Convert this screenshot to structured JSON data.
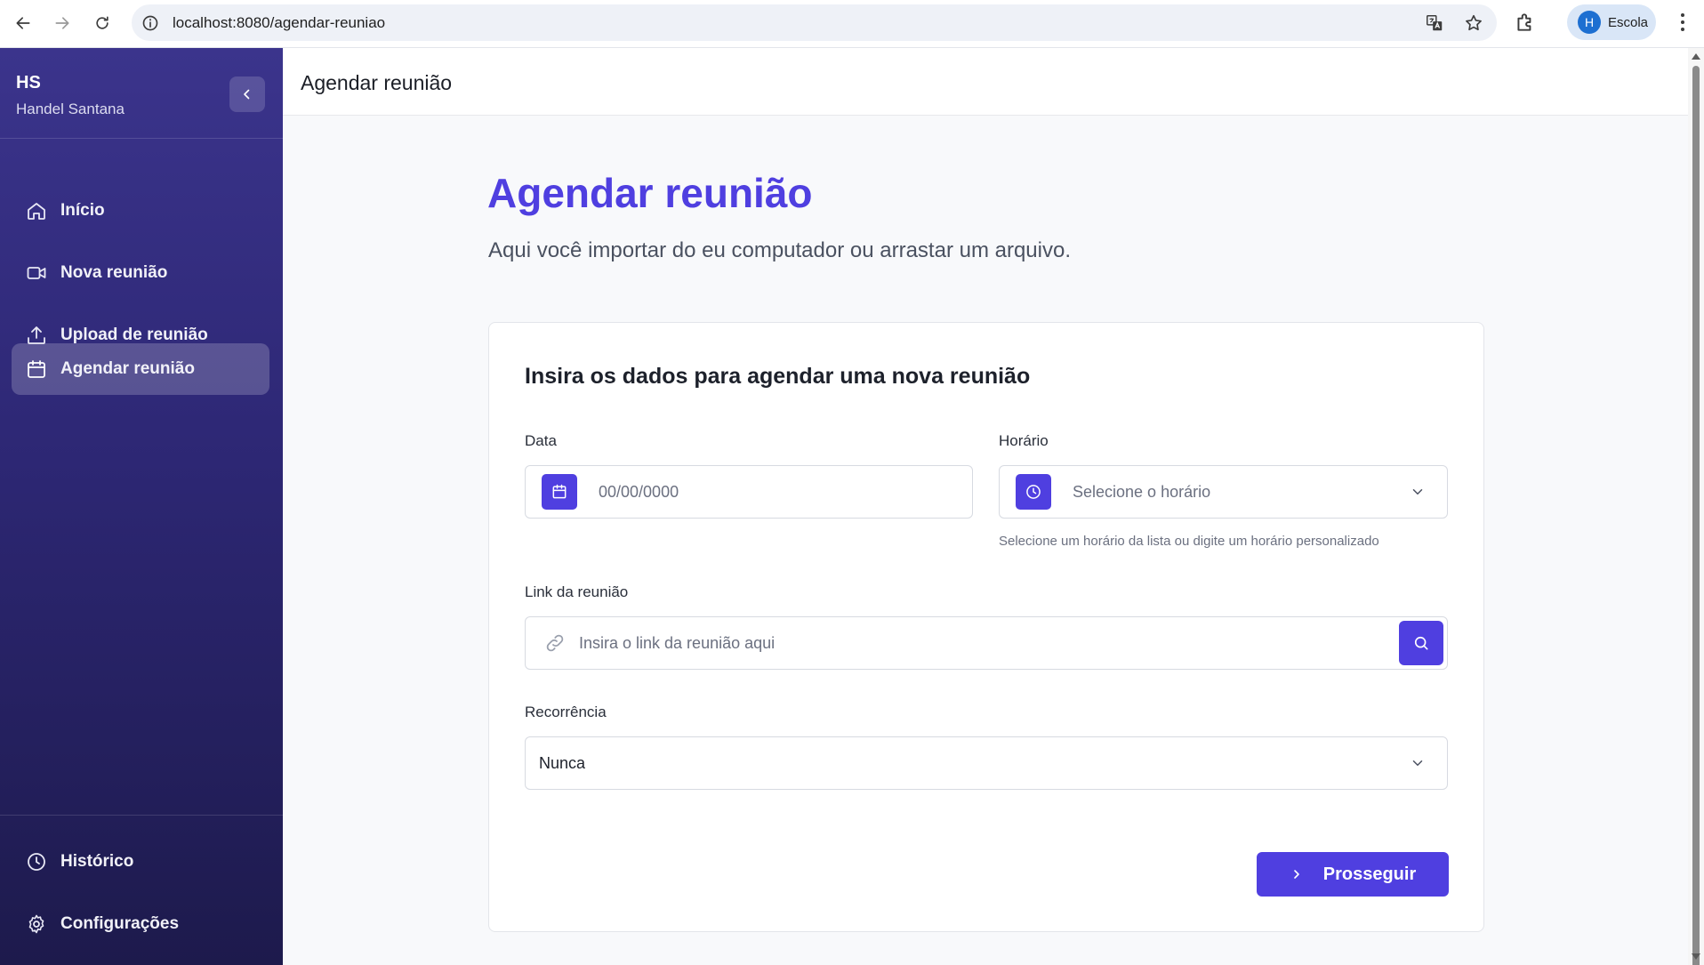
{
  "browser": {
    "url": "localhost:8080/agendar-reuniao",
    "profile_initial": "H",
    "profile_name": "Escola"
  },
  "sidebar": {
    "initials": "HS",
    "user_name": "Handel Santana",
    "items": [
      {
        "label": "Início",
        "icon": "home-icon"
      },
      {
        "label": "Nova reunião",
        "icon": "video-icon"
      },
      {
        "label": "Upload de reunião",
        "icon": "upload-icon"
      },
      {
        "label": "Agendar reunião",
        "icon": "calendar-icon",
        "active": true
      }
    ],
    "footer_items": [
      {
        "label": "Histórico",
        "icon": "clock-icon"
      },
      {
        "label": "Configurações",
        "icon": "gear-icon"
      }
    ]
  },
  "topbar": {
    "title": "Agendar reunião"
  },
  "main": {
    "title": "Agendar reunião",
    "subtitle": "Aqui você importar do eu computador ou arrastar um arquivo."
  },
  "form": {
    "heading": "Insira os dados para agendar uma nova reunião",
    "date": {
      "label": "Data",
      "placeholder": "00/00/0000"
    },
    "time": {
      "label": "Horário",
      "placeholder": "Selecione o horário",
      "hint": "Selecione um horário da lista ou digite um horário personalizado"
    },
    "link": {
      "label": "Link da reunião",
      "placeholder": "Insira o link da reunião aqui"
    },
    "recurrence": {
      "label": "Recorrência",
      "value": "Nunca"
    },
    "submit_label": "Prosseguir"
  },
  "colors": {
    "accent": "#4f3fe0",
    "sidebar_top": "#3b348c",
    "sidebar_bottom": "#1d1a4c"
  }
}
